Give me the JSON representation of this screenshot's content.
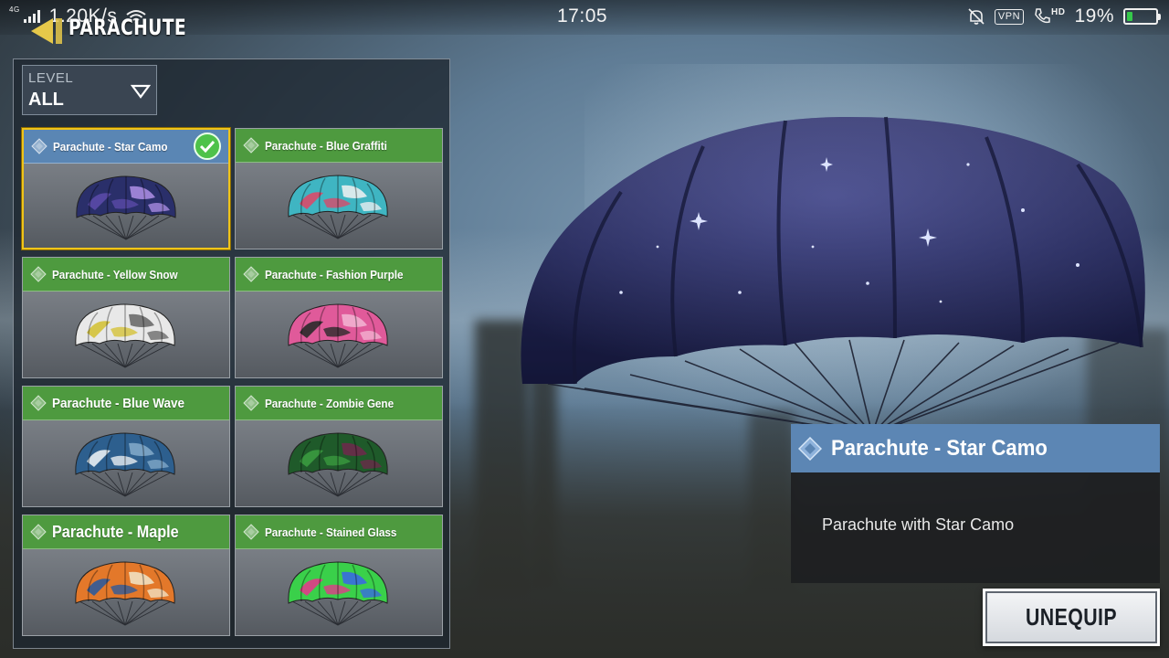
{
  "status_bar": {
    "network": "4G",
    "speed": "1.20K/s",
    "time": "17:05",
    "vpn": "VPN",
    "hd": "HD",
    "battery": "19%",
    "battery_level": 0.19
  },
  "header": {
    "title": "PARACHUTE"
  },
  "filter": {
    "label": "LEVEL",
    "value": "ALL"
  },
  "items": [
    {
      "name": "Parachute - Star Camo",
      "selected": true,
      "equipped": true,
      "colors": [
        "#2a2f6a",
        "#5a4aa8",
        "#a78be0"
      ]
    },
    {
      "name": "Parachute - Blue Graffiti",
      "colors": [
        "#3fb5c2",
        "#d94a6a",
        "#e8eef0"
      ]
    },
    {
      "name": "Parachute - Yellow Snow",
      "colors": [
        "#e8e8e8",
        "#d4c23a",
        "#6b6b6b"
      ]
    },
    {
      "name": "Parachute - Fashion Purple",
      "colors": [
        "#e05a9a",
        "#2a2a2a",
        "#f2b0d0"
      ]
    },
    {
      "name": "Parachute - Blue Wave",
      "colors": [
        "#2d5f8e",
        "#e8eef3",
        "#7fa7c8"
      ]
    },
    {
      "name": "Parachute - Zombie Gene",
      "colors": [
        "#1f5a2a",
        "#3a9a3f",
        "#6a2a4a"
      ]
    },
    {
      "name": "Parachute - Maple",
      "colors": [
        "#e3782a",
        "#2e5a9a",
        "#f0e0c0"
      ]
    },
    {
      "name": "Parachute - Stained Glass",
      "colors": [
        "#3ad04a",
        "#e23a8a",
        "#3a6ae0"
      ]
    }
  ],
  "detail": {
    "title": "Parachute - Star Camo",
    "description": "Parachute with Star Camo"
  },
  "actions": {
    "unequip": "UNEQUIP"
  }
}
